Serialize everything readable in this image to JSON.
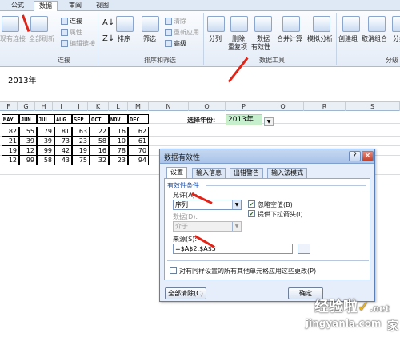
{
  "ribbon": {
    "tabs": [
      "公式",
      "数据",
      "审阅",
      "视图"
    ],
    "active_tab": "数据",
    "items": {
      "existing_connections": "现有连接",
      "refresh_all": "全部刷新",
      "connections": "连接",
      "properties": "属性",
      "edit_links": "编辑链接",
      "sort": "排序",
      "filter": "筛选",
      "clear": "清除",
      "reapply": "重新应用",
      "advanced": "高级",
      "text_to_columns": "分列",
      "remove_dup_1": "删除",
      "remove_dup_2": "重复项",
      "data_valid_1": "数据",
      "data_valid_2": "有效性",
      "consolidate": "合并计算",
      "whatif": "模拟分析",
      "group": "创建组",
      "ungroup": "取消组合",
      "subtotal": "分类"
    },
    "groups": [
      "连接",
      "排序和筛选",
      "数据工具",
      "分级"
    ]
  },
  "formula_bar": {
    "value": "2013年"
  },
  "columns": [
    "F",
    "G",
    "H",
    "I",
    "J",
    "K",
    "L",
    "M",
    "N",
    "O",
    "P",
    "Q",
    "R",
    "S"
  ],
  "table": {
    "headers": [
      "MAY",
      "JUN",
      "JUL",
      "AUG",
      "SEP",
      "OCT",
      "NOV",
      "DEC"
    ],
    "rows": [
      [
        "82",
        "55",
        "79",
        "81",
        "63",
        "22",
        "16",
        "62"
      ],
      [
        "21",
        "39",
        "39",
        "73",
        "23",
        "58",
        "10",
        "61"
      ],
      [
        "19",
        "12",
        "99",
        "42",
        "19",
        "16",
        "78",
        "70"
      ],
      [
        "12",
        "99",
        "58",
        "43",
        "75",
        "32",
        "23",
        "94"
      ]
    ]
  },
  "year_select": {
    "label": "选择年份:",
    "value": "2013年"
  },
  "dialog": {
    "title": "数据有效性",
    "help": "?",
    "tabs": [
      "设置",
      "输入信息",
      "出错警告",
      "输入法模式"
    ],
    "active_tab": "设置",
    "section": "有效性条件",
    "allow_label": "允许(A):",
    "allow_value": "序列",
    "data_label": "数据(D):",
    "data_value": "介于",
    "ignore_blank": "忽略空值(B)",
    "dropdown": "提供下拉箭头(I)",
    "source_label": "来源(S):",
    "source_value": "=$A$2:$A$5",
    "apply_all": "对有同样设置的所有其他单元格应用这些更改(P)",
    "clear_all": "全部清除(C)",
    "ok": "确定"
  },
  "watermark": {
    "line1": "经验啦",
    "check": "✓",
    "line2": "jingyanla.com",
    "suffix": ".net",
    "corner": "家"
  }
}
